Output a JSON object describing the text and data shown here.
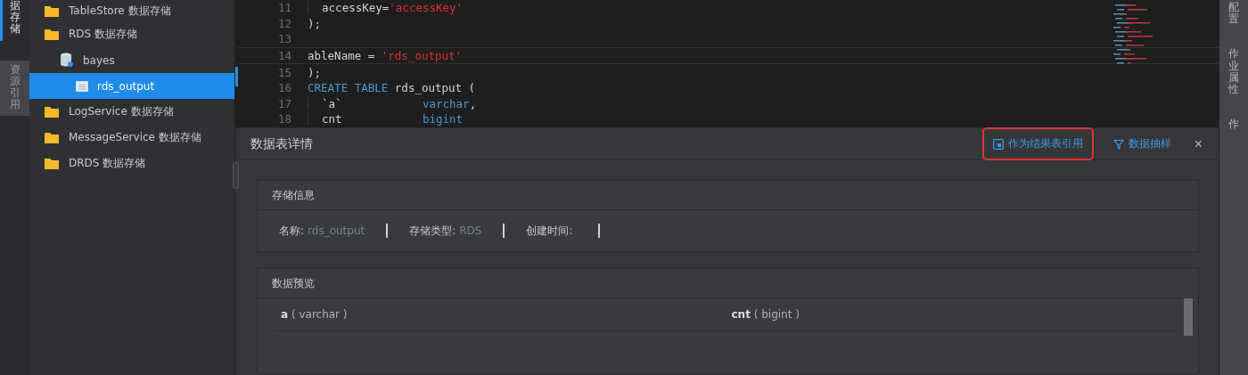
{
  "left_tabs": [
    {
      "label": "据存储",
      "selected": true
    },
    {
      "label": "资源引用",
      "selected": false
    }
  ],
  "tree": [
    {
      "label": "TableStore 数据存储",
      "kind": "folder",
      "selected": false
    },
    {
      "label": "RDS 数据存储",
      "kind": "folder",
      "selected": false,
      "children": [
        {
          "label": "bayes",
          "kind": "database",
          "selected": false,
          "children": [
            {
              "label": "rds_output",
              "kind": "table",
              "selected": true
            }
          ]
        }
      ]
    },
    {
      "label": "LogService 数据存储",
      "kind": "folder",
      "selected": false
    },
    {
      "label": "MessageService 数据存储",
      "kind": "folder",
      "selected": false
    },
    {
      "label": "DRDS 数据存储",
      "kind": "folder",
      "selected": false
    }
  ],
  "editor": {
    "lines": [
      {
        "number": "11",
        "current": false,
        "indent": true,
        "tokens": [
          {
            "kind": "plain",
            "text": "  accessKey="
          },
          {
            "kind": "string",
            "text": "'accessKey'"
          }
        ]
      },
      {
        "number": "12",
        "current": false,
        "indent": false,
        "tokens": [
          {
            "kind": "plain",
            "text": ");"
          }
        ]
      },
      {
        "number": "13",
        "current": false
      },
      {
        "number": "14",
        "current": true,
        "indent": false,
        "tokens": [
          {
            "kind": "plain",
            "text": "ableName = "
          },
          {
            "kind": "string",
            "text": "'rds_output'"
          }
        ]
      },
      {
        "number": "15",
        "current": false,
        "indent": false,
        "tokens": [
          {
            "kind": "plain",
            "text": ");"
          }
        ]
      },
      {
        "number": "16",
        "current": false,
        "indent": false,
        "tokens": [
          {
            "kind": "keyword",
            "text": "CREATE TABLE"
          },
          {
            "kind": "plain",
            "text": " rds_output ("
          }
        ]
      },
      {
        "number": "17",
        "current": false,
        "indent": true,
        "tokens": [
          {
            "kind": "plain",
            "text": "  `a`            "
          },
          {
            "kind": "keyword",
            "text": "varchar"
          },
          {
            "kind": "plain",
            "text": ","
          }
        ]
      },
      {
        "number": "18",
        "current": false,
        "indent": true,
        "tokens": [
          {
            "kind": "plain",
            "text": "  cnt            "
          },
          {
            "kind": "keyword",
            "text": "bigint"
          }
        ]
      }
    ]
  },
  "right_tabs": [
    {
      "label": "配置"
    },
    {
      "label": "作业属性"
    },
    {
      "label": "作"
    }
  ],
  "detail": {
    "title": "数据表详情",
    "actions": [
      {
        "label": "作为结果表引用",
        "kind": "reference",
        "highlighted": true
      },
      {
        "label": "数据抽样",
        "kind": "sample",
        "highlighted": false
      }
    ],
    "close": "×",
    "storage": {
      "title": "存储信息",
      "fields": [
        {
          "label": "名称:",
          "value": "rds_output"
        },
        {
          "label": "存储类型:",
          "value": "RDS"
        },
        {
          "label": "创建时间:"
        }
      ]
    },
    "preview": {
      "title": "数据预览",
      "columns": [
        {
          "name": "a",
          "type": "( varchar )"
        },
        {
          "name": "cnt",
          "type": "( bigint )"
        }
      ]
    }
  }
}
